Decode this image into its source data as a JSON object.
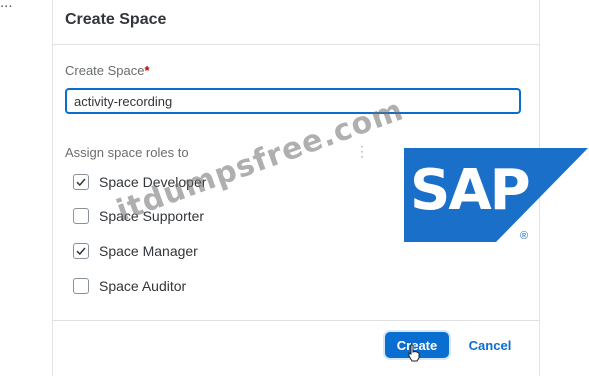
{
  "dialog": {
    "title": "Create Space",
    "name_field": {
      "label": "Create Space",
      "required_mark": "*",
      "value": "activity-recording"
    },
    "roles_label": "Assign space roles to",
    "roles": [
      {
        "label": "Space Developer",
        "checked": true
      },
      {
        "label": "Space Supporter",
        "checked": false
      },
      {
        "label": "Space Manager",
        "checked": true
      },
      {
        "label": "Space Auditor",
        "checked": false
      }
    ],
    "buttons": {
      "create": "Create",
      "cancel": "Cancel"
    }
  },
  "overlay": {
    "watermark": "itdumpsfree.com",
    "logo_text": "SAP",
    "logo_registered": "®"
  },
  "colors": {
    "accent": "#0a6ed1",
    "required": "#bb0000",
    "sap_blue": "#1a6fc9"
  }
}
